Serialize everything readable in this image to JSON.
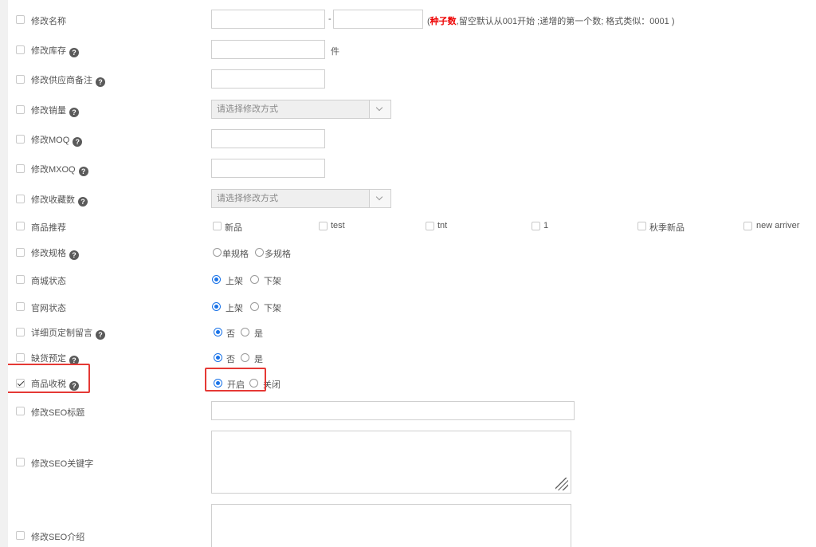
{
  "rows": {
    "name": {
      "label": "修改名称",
      "dash": "-",
      "hint_open": "(",
      "hint_bold": "种子数",
      "hint_rest": ",留空默认从001开始 ;递增的第一个数; 格式类似：0001 )"
    },
    "stock": {
      "label": "修改库存",
      "unit": "件"
    },
    "supplier_note": {
      "label": "修改供应商备注"
    },
    "sales": {
      "label": "修改销量",
      "select_value": "请选择修改方式"
    },
    "moq": {
      "label": "修改MOQ"
    },
    "mxoq": {
      "label": "修改MXOQ"
    },
    "favorites": {
      "label": "修改收藏数",
      "select_value": "请选择修改方式"
    },
    "recommend": {
      "label": "商品推荐",
      "options": [
        "新品",
        "test",
        "tnt",
        "1",
        "秋季新品",
        "new arriver"
      ]
    },
    "spec": {
      "label": "修改规格",
      "options": [
        "单规格",
        "多规格"
      ]
    },
    "mall_status": {
      "label": "商城状态",
      "options": [
        "上架",
        "下架"
      ],
      "selected": "上架"
    },
    "site_status": {
      "label": "官网状态",
      "options": [
        "上架",
        "下架"
      ],
      "selected": "上架"
    },
    "detail_message": {
      "label": "详细页定制留言",
      "options": [
        "否",
        "是"
      ],
      "selected": "否"
    },
    "preorder": {
      "label": "缺货预定",
      "options": [
        "否",
        "是"
      ],
      "selected": "否"
    },
    "tax": {
      "label": "商品收税",
      "checked": true,
      "options": [
        "开启",
        "关闭"
      ],
      "selected": "开启"
    },
    "seo_title": {
      "label": "修改SEO标题"
    },
    "seo_keywords": {
      "label": "修改SEO关键字"
    },
    "seo_desc": {
      "label": "修改SEO介绍"
    }
  },
  "help_glyph": "?",
  "colors": {
    "accent": "#1a73e8",
    "highlight": "#e53935",
    "hint_red": "#e00000"
  }
}
